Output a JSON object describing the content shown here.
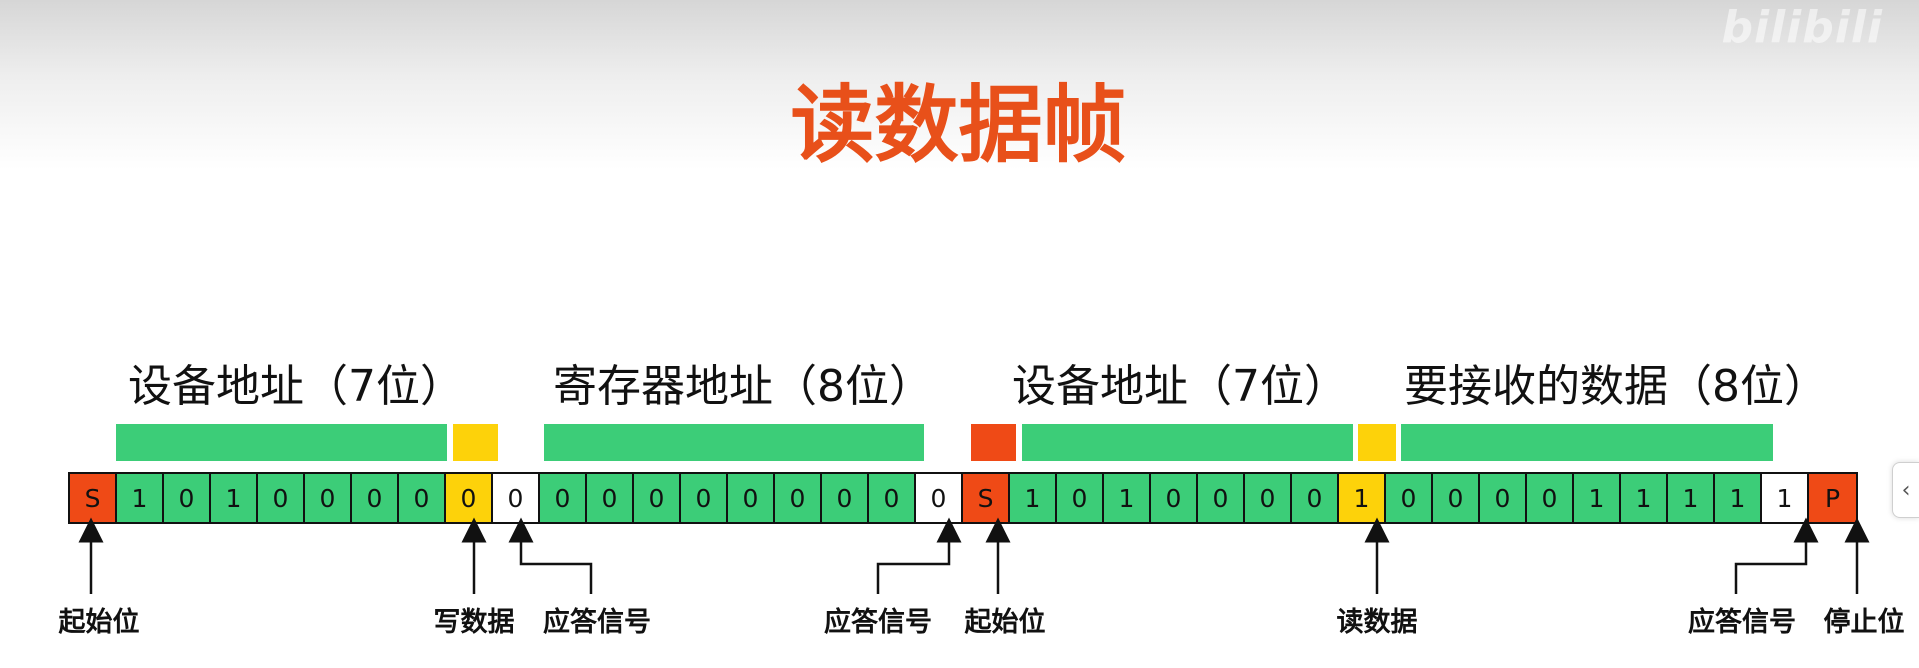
{
  "title": "读数据帧",
  "watermark": "bilibili",
  "colors": {
    "start": "#ef4a16",
    "data": "#3ccd78",
    "rw": "#fdd20a",
    "ack": "#ffffff",
    "stop": "#ef4a16",
    "title": "#e8501a"
  },
  "section_labels": [
    "设备地址（7位）",
    "寄存器地址（8位）",
    "设备地址（7位）",
    "要接收的数据（8位）"
  ],
  "bits": [
    {
      "text": "S",
      "type": "start"
    },
    {
      "text": "1",
      "type": "data"
    },
    {
      "text": "0",
      "type": "data"
    },
    {
      "text": "1",
      "type": "data"
    },
    {
      "text": "0",
      "type": "data"
    },
    {
      "text": "0",
      "type": "data"
    },
    {
      "text": "0",
      "type": "data"
    },
    {
      "text": "0",
      "type": "data"
    },
    {
      "text": "0",
      "type": "rw"
    },
    {
      "text": "0",
      "type": "ack"
    },
    {
      "text": "0",
      "type": "data"
    },
    {
      "text": "0",
      "type": "data"
    },
    {
      "text": "0",
      "type": "data"
    },
    {
      "text": "0",
      "type": "data"
    },
    {
      "text": "0",
      "type": "data"
    },
    {
      "text": "0",
      "type": "data"
    },
    {
      "text": "0",
      "type": "data"
    },
    {
      "text": "0",
      "type": "data"
    },
    {
      "text": "0",
      "type": "ack"
    },
    {
      "text": "S",
      "type": "start"
    },
    {
      "text": "1",
      "type": "data"
    },
    {
      "text": "0",
      "type": "data"
    },
    {
      "text": "1",
      "type": "data"
    },
    {
      "text": "0",
      "type": "data"
    },
    {
      "text": "0",
      "type": "data"
    },
    {
      "text": "0",
      "type": "data"
    },
    {
      "text": "0",
      "type": "data"
    },
    {
      "text": "1",
      "type": "rw"
    },
    {
      "text": "0",
      "type": "data"
    },
    {
      "text": "0",
      "type": "data"
    },
    {
      "text": "0",
      "type": "data"
    },
    {
      "text": "0",
      "type": "data"
    },
    {
      "text": "1",
      "type": "data"
    },
    {
      "text": "1",
      "type": "data"
    },
    {
      "text": "1",
      "type": "data"
    },
    {
      "text": "1",
      "type": "data"
    },
    {
      "text": "1",
      "type": "ack"
    },
    {
      "text": "P",
      "type": "stop"
    }
  ],
  "markers": [
    "起始位",
    "写数据",
    "应答信号",
    "应答信号",
    "起始位",
    "读数据",
    "应答信号",
    "停止位"
  ],
  "side_tab_icon": "chevron-left-icon"
}
